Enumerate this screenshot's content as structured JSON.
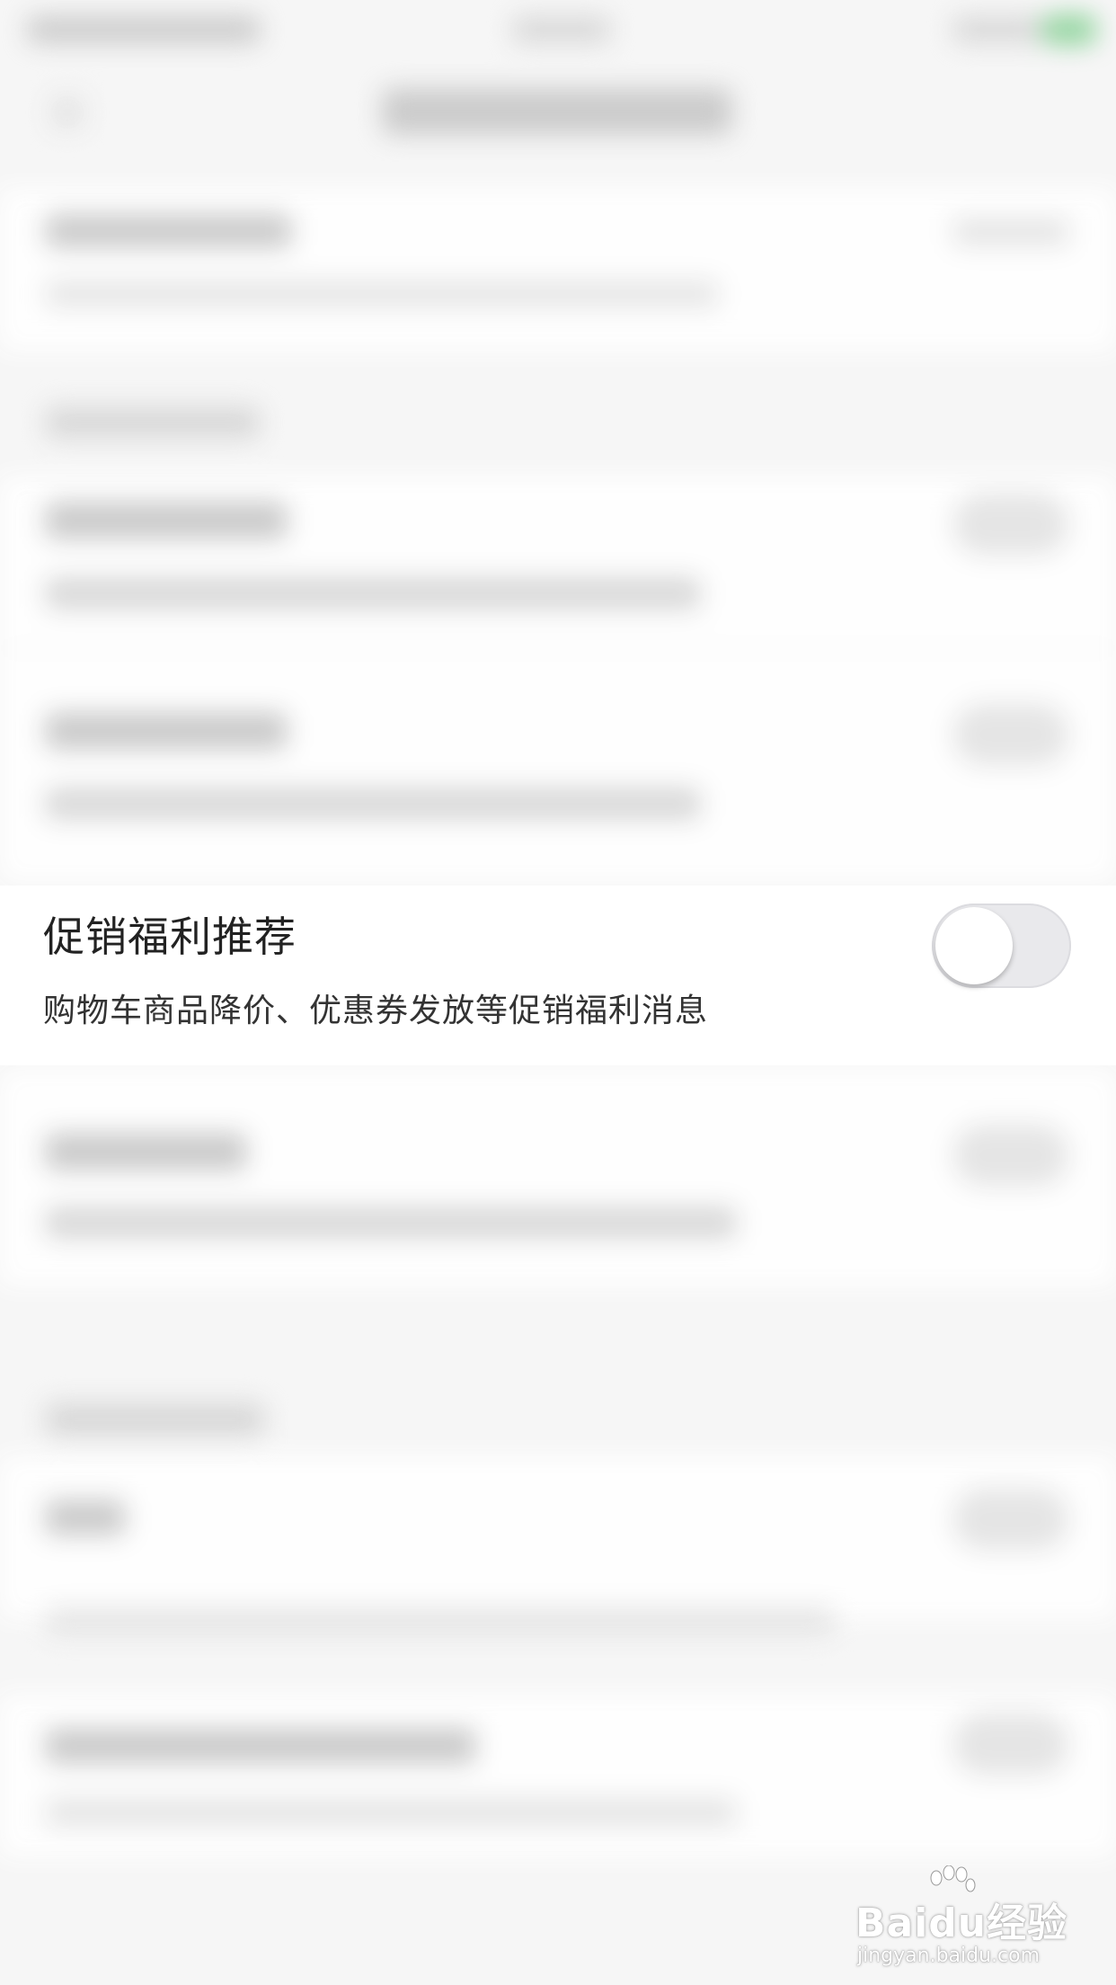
{
  "promo_setting": {
    "title": "促销福利推荐",
    "description": "购物车商品降价、优惠券发放等促销福利消息",
    "toggle_on": false
  },
  "watermark": {
    "main": "Baidu经验",
    "sub": "jingyan.baidu.com"
  },
  "colors": {
    "toggle_track": "#e9e9ec",
    "background": "#f6f6f6",
    "status_battery": "#8fd39c"
  }
}
